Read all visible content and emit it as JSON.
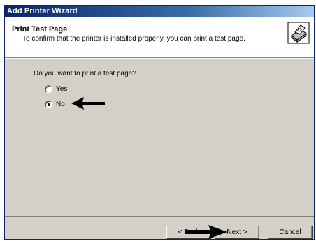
{
  "window": {
    "title": "Add Printer Wizard"
  },
  "header": {
    "title": "Print Test Page",
    "subtitle": "To confirm that the printer is installed properly, you can print a test page.",
    "icon": "printer-icon"
  },
  "body": {
    "question": "Do you want to print a test page?",
    "options": [
      {
        "label": "Yes",
        "selected": false
      },
      {
        "label": "No",
        "selected": true
      }
    ]
  },
  "buttons": {
    "back": "< Back",
    "next": "Next >",
    "cancel": "Cancel"
  },
  "annotations": {
    "arrow_icon": "arrow-left-icon"
  }
}
